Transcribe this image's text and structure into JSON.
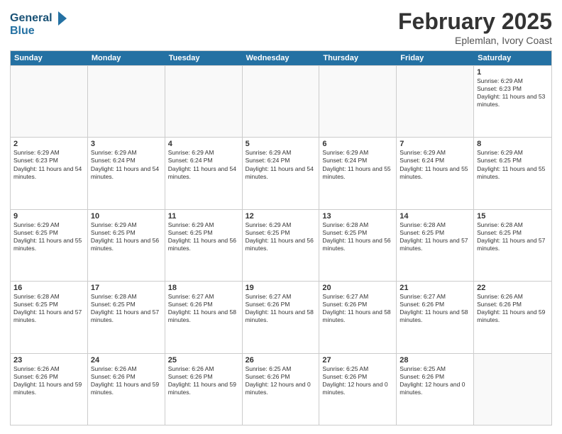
{
  "logo": {
    "line1": "General",
    "line2": "Blue"
  },
  "title": "February 2025",
  "location": "Eplemlan, Ivory Coast",
  "days_of_week": [
    "Sunday",
    "Monday",
    "Tuesday",
    "Wednesday",
    "Thursday",
    "Friday",
    "Saturday"
  ],
  "weeks": [
    [
      {
        "day": "",
        "info": ""
      },
      {
        "day": "",
        "info": ""
      },
      {
        "day": "",
        "info": ""
      },
      {
        "day": "",
        "info": ""
      },
      {
        "day": "",
        "info": ""
      },
      {
        "day": "",
        "info": ""
      },
      {
        "day": "1",
        "info": "Sunrise: 6:29 AM\nSunset: 6:23 PM\nDaylight: 11 hours and 53 minutes."
      }
    ],
    [
      {
        "day": "2",
        "info": "Sunrise: 6:29 AM\nSunset: 6:23 PM\nDaylight: 11 hours and 54 minutes."
      },
      {
        "day": "3",
        "info": "Sunrise: 6:29 AM\nSunset: 6:24 PM\nDaylight: 11 hours and 54 minutes."
      },
      {
        "day": "4",
        "info": "Sunrise: 6:29 AM\nSunset: 6:24 PM\nDaylight: 11 hours and 54 minutes."
      },
      {
        "day": "5",
        "info": "Sunrise: 6:29 AM\nSunset: 6:24 PM\nDaylight: 11 hours and 54 minutes."
      },
      {
        "day": "6",
        "info": "Sunrise: 6:29 AM\nSunset: 6:24 PM\nDaylight: 11 hours and 55 minutes."
      },
      {
        "day": "7",
        "info": "Sunrise: 6:29 AM\nSunset: 6:24 PM\nDaylight: 11 hours and 55 minutes."
      },
      {
        "day": "8",
        "info": "Sunrise: 6:29 AM\nSunset: 6:25 PM\nDaylight: 11 hours and 55 minutes."
      }
    ],
    [
      {
        "day": "9",
        "info": "Sunrise: 6:29 AM\nSunset: 6:25 PM\nDaylight: 11 hours and 55 minutes."
      },
      {
        "day": "10",
        "info": "Sunrise: 6:29 AM\nSunset: 6:25 PM\nDaylight: 11 hours and 56 minutes."
      },
      {
        "day": "11",
        "info": "Sunrise: 6:29 AM\nSunset: 6:25 PM\nDaylight: 11 hours and 56 minutes."
      },
      {
        "day": "12",
        "info": "Sunrise: 6:29 AM\nSunset: 6:25 PM\nDaylight: 11 hours and 56 minutes."
      },
      {
        "day": "13",
        "info": "Sunrise: 6:28 AM\nSunset: 6:25 PM\nDaylight: 11 hours and 56 minutes."
      },
      {
        "day": "14",
        "info": "Sunrise: 6:28 AM\nSunset: 6:25 PM\nDaylight: 11 hours and 57 minutes."
      },
      {
        "day": "15",
        "info": "Sunrise: 6:28 AM\nSunset: 6:25 PM\nDaylight: 11 hours and 57 minutes."
      }
    ],
    [
      {
        "day": "16",
        "info": "Sunrise: 6:28 AM\nSunset: 6:25 PM\nDaylight: 11 hours and 57 minutes."
      },
      {
        "day": "17",
        "info": "Sunrise: 6:28 AM\nSunset: 6:25 PM\nDaylight: 11 hours and 57 minutes."
      },
      {
        "day": "18",
        "info": "Sunrise: 6:27 AM\nSunset: 6:26 PM\nDaylight: 11 hours and 58 minutes."
      },
      {
        "day": "19",
        "info": "Sunrise: 6:27 AM\nSunset: 6:26 PM\nDaylight: 11 hours and 58 minutes."
      },
      {
        "day": "20",
        "info": "Sunrise: 6:27 AM\nSunset: 6:26 PM\nDaylight: 11 hours and 58 minutes."
      },
      {
        "day": "21",
        "info": "Sunrise: 6:27 AM\nSunset: 6:26 PM\nDaylight: 11 hours and 58 minutes."
      },
      {
        "day": "22",
        "info": "Sunrise: 6:26 AM\nSunset: 6:26 PM\nDaylight: 11 hours and 59 minutes."
      }
    ],
    [
      {
        "day": "23",
        "info": "Sunrise: 6:26 AM\nSunset: 6:26 PM\nDaylight: 11 hours and 59 minutes."
      },
      {
        "day": "24",
        "info": "Sunrise: 6:26 AM\nSunset: 6:26 PM\nDaylight: 11 hours and 59 minutes."
      },
      {
        "day": "25",
        "info": "Sunrise: 6:26 AM\nSunset: 6:26 PM\nDaylight: 11 hours and 59 minutes."
      },
      {
        "day": "26",
        "info": "Sunrise: 6:25 AM\nSunset: 6:26 PM\nDaylight: 12 hours and 0 minutes."
      },
      {
        "day": "27",
        "info": "Sunrise: 6:25 AM\nSunset: 6:26 PM\nDaylight: 12 hours and 0 minutes."
      },
      {
        "day": "28",
        "info": "Sunrise: 6:25 AM\nSunset: 6:26 PM\nDaylight: 12 hours and 0 minutes."
      },
      {
        "day": "",
        "info": ""
      }
    ]
  ]
}
